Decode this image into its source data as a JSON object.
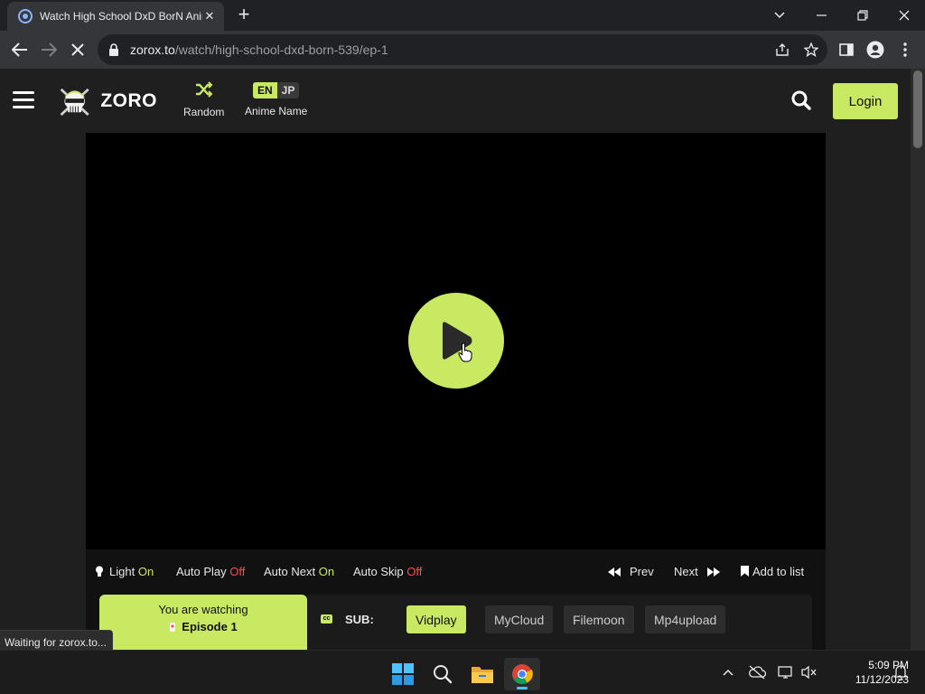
{
  "browser": {
    "tab_title": "Watch High School DxD BorN Anime",
    "tab_close": "✕",
    "new_tab": "+",
    "url_host": "zorox.to",
    "url_path": "/watch/high-school-dxd-born-539/ep-1",
    "status_text": "Waiting for zorox.to..."
  },
  "site": {
    "logo_text": "ZORO",
    "nav": {
      "random_label": "Random",
      "anime_name_label": "Anime Name",
      "lang_en": "EN",
      "lang_jp": "JP"
    },
    "login_label": "Login"
  },
  "controls": {
    "light_label": "Light",
    "light_state": "On",
    "autoplay_label": "Auto Play",
    "autoplay_state": "Off",
    "autonext_label": "Auto Next",
    "autonext_state": "On",
    "autoskip_label": "Auto Skip",
    "autoskip_state": "Off",
    "prev_label": "Prev",
    "next_label": "Next",
    "add_to_list_label": "Add to list"
  },
  "episode": {
    "watching_label": "You are watching",
    "episode_label": "Episode 1",
    "sub_badge": "cc",
    "sub_label": "SUB:",
    "servers": [
      "Vidplay",
      "MyCloud",
      "Filemoon",
      "Mp4upload"
    ],
    "active_server": "Vidplay"
  },
  "taskbar": {
    "time": "5:09 PM",
    "date": "11/12/2023"
  },
  "colors": {
    "accent": "#cae962",
    "off_red": "#ff4b4b",
    "page_bg": "#1f1f1f"
  }
}
